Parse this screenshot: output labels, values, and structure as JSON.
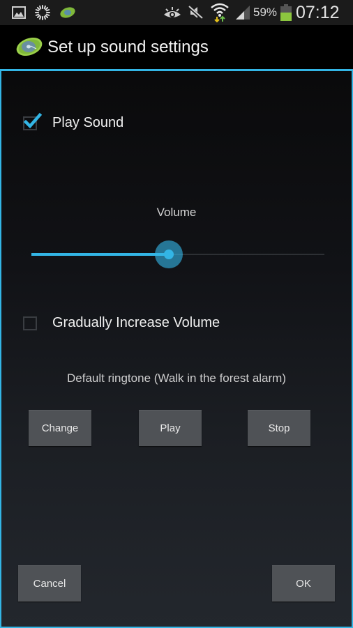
{
  "status_bar": {
    "left_icons": [
      "gallery-icon",
      "loading-spinner-icon",
      "app-notification-icon"
    ],
    "right_icons": [
      "eye-icon",
      "mute-icon",
      "wifi-icon",
      "signal-icon",
      "battery-icon"
    ],
    "battery_percent": "59%",
    "battery_level": 0.59,
    "time": "07:12",
    "colors": {
      "battery": "#8cc63f",
      "wifi_arrows_down": "#e6c21a",
      "wifi_arrows_up": "#6cc04a"
    }
  },
  "title_bar": {
    "title": "Set up sound settings",
    "icon": "app-cd-icon"
  },
  "dialog": {
    "accent_color": "#33b5e5",
    "play_sound": {
      "label": "Play Sound",
      "checked": true
    },
    "volume": {
      "label": "Volume",
      "value_fraction": 0.47
    },
    "gradual_increase": {
      "label": "Gradually Increase Volume",
      "checked": false
    },
    "ringtone_text": "Default ringtone (Walk in the forest alarm)",
    "ringtone_buttons": {
      "change": "Change",
      "play": "Play",
      "stop": "Stop"
    },
    "footer_buttons": {
      "cancel": "Cancel",
      "ok": "OK"
    }
  }
}
